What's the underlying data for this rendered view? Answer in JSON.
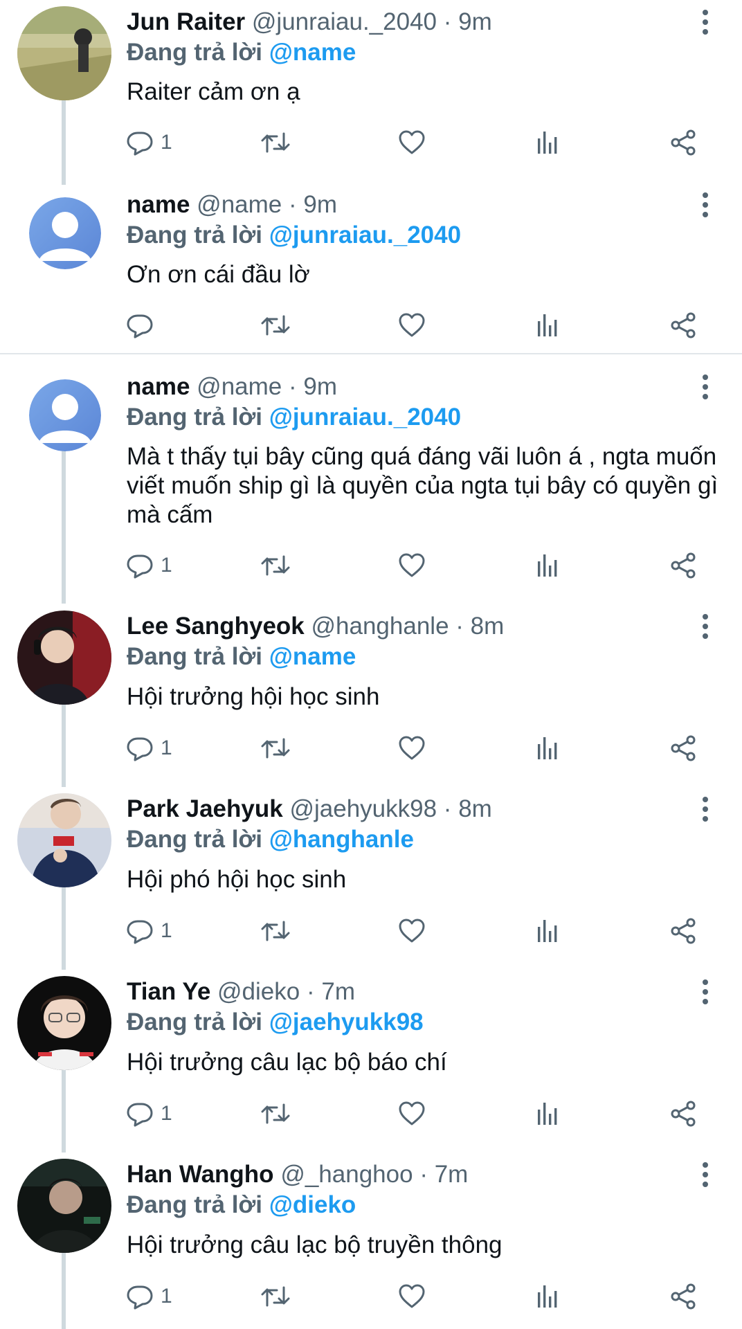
{
  "replying_prefix": "Đang trả lời",
  "separator": "·",
  "colors": {
    "accent": "#1d9bf0",
    "secondary_text": "#536471",
    "primary_text": "#0f1419",
    "thread_line": "#cfd9de"
  },
  "tweets": [
    {
      "name": "Jun Raiter",
      "handle": "@junraiau._2040",
      "time": "9m",
      "replying_to": "@name",
      "text": "Raiter cảm ơn ạ",
      "reply_count": "1",
      "avatar": "photo-field"
    },
    {
      "name": "name",
      "handle": "@name",
      "time": "9m",
      "replying_to": "@junraiau._2040",
      "text": "Ơn ơn cái đầu lờ",
      "reply_count": "",
      "avatar": "default-person"
    },
    {
      "name": "name",
      "handle": "@name",
      "time": "9m",
      "replying_to": "@junraiau._2040",
      "text": "Mà t thấy tụi bây cũng quá đáng vãi luôn á , ngta muốn viết muốn ship gì là quyền của ngta tụi bây có quyền gì mà cấm",
      "reply_count": "1",
      "avatar": "default-person"
    },
    {
      "name": "Lee Sanghyeok",
      "handle": "@hanghanle",
      "time": "8m",
      "replying_to": "@name",
      "text": "Hội trưởng hội học sinh",
      "reply_count": "1",
      "avatar": "photo-gamer-red"
    },
    {
      "name": "Park Jaehyuk",
      "handle": "@jaehyukk98",
      "time": "8m",
      "replying_to": "@hanghanle",
      "text": "Hội phó hội học sinh",
      "reply_count": "1",
      "avatar": "photo-gamer-jacket"
    },
    {
      "name": "Tian Ye",
      "handle": "@dieko",
      "time": "7m",
      "replying_to": "@jaehyukk98",
      "text": "Hội trưởng câu lạc bộ báo chí",
      "reply_count": "1",
      "avatar": "photo-glasses"
    },
    {
      "name": "Han Wangho",
      "handle": "@_hanghoo",
      "time": "7m",
      "replying_to": "@dieko",
      "text": "Hội trưởng câu lạc bộ truyền thông",
      "reply_count": "1",
      "avatar": "photo-dark"
    }
  ],
  "icons": {
    "reply": "reply-icon",
    "retweet": "retweet-icon",
    "like": "heart-icon",
    "views": "analytics-icon",
    "share": "share-icon",
    "more": "more-vertical-icon"
  }
}
